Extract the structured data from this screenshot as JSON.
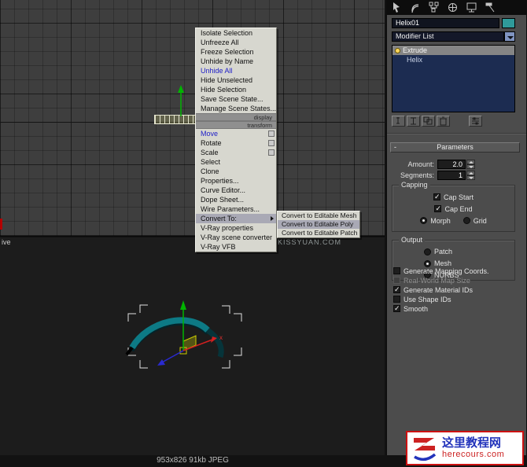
{
  "context_menu": {
    "items": [
      "Isolate Selection",
      "Unfreeze All",
      "Freeze Selection",
      "Unhide by Name",
      "Unhide All",
      "Hide Unselected",
      "Hide Selection",
      "Save Scene State...",
      "Manage Scene States...",
      "Move",
      "Rotate",
      "Scale",
      "Select",
      "Clone",
      "Properties...",
      "Curve Editor...",
      "Dope Sheet...",
      "Wire Parameters...",
      "Convert To:",
      "V-Ray properties",
      "V-Ray scene converter",
      "V-Ray VFB"
    ],
    "section_labels": [
      "display",
      "transform"
    ],
    "submenu_items": [
      "Convert to Editable Mesh",
      "Convert to Editable Poly",
      "Convert to Editable Patch"
    ]
  },
  "viewport": {
    "label": "ive",
    "watermark": "KISSYUAN.COM",
    "axis_label_x": "x"
  },
  "command_panel": {
    "tab_icons": [
      "create",
      "modify",
      "hierarchy",
      "motion",
      "display",
      "utilities"
    ],
    "object_name": "Helix01",
    "object_color": "#2f9a9a",
    "modifier_list_label": "Modifier List",
    "modifier_stack": [
      "Extrude",
      "Helix"
    ],
    "parameters": {
      "rollout_title": "Parameters",
      "collapse_glyph": "-",
      "amount_label": "Amount:",
      "amount_value": "2.0",
      "segments_label": "Segments:",
      "segments_value": "1",
      "capping_title": "Capping",
      "cap_start": "Cap Start",
      "cap_end": "Cap End",
      "morph": "Morph",
      "grid": "Grid",
      "output_title": "Output",
      "patch": "Patch",
      "mesh": "Mesh",
      "nurbs": "NURBS",
      "gen_mapping": "Generate Mapping Coords.",
      "real_world": "Real-World Map Size",
      "gen_material": "Generate Material IDs",
      "use_shape": "Use Shape IDs",
      "smooth": "Smooth",
      "states": {
        "cap_start": true,
        "cap_end": true,
        "capping_mode": "Morph",
        "output_mode": "Mesh",
        "generate_mapping_coords": false,
        "real_world_map_size": false,
        "generate_material_ids": true,
        "use_shape_ids": false,
        "smooth": true
      }
    }
  },
  "footer": {
    "status_text": "953x826  91kb  JPEG"
  },
  "branding": {
    "site_name": "这里教程网",
    "site_url": "herecours.com"
  }
}
